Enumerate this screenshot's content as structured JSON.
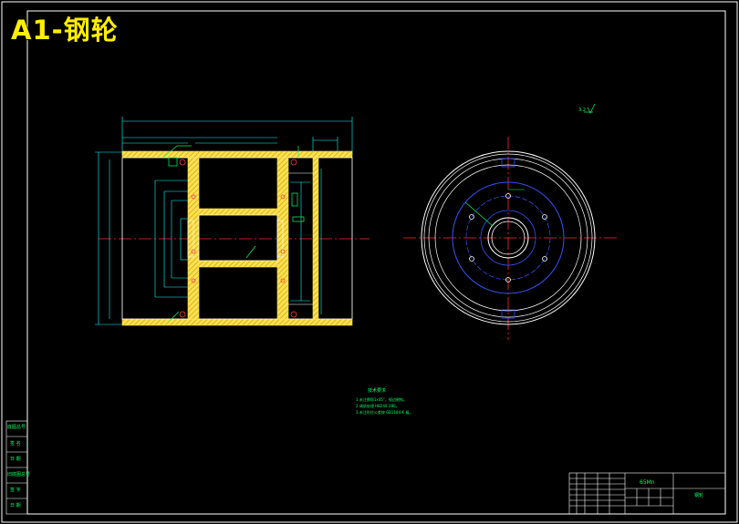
{
  "title": "A1-钢轮",
  "annotations": {
    "surface_mark": "3.2",
    "tech_req_heading": "技术要求",
    "tech_req_lines": [
      "1.未注倒角1x45°，锐边倒钝。",
      "2.调质处理 HB240-280。",
      "3.未注形位公差按 GB1184-K 级。"
    ]
  },
  "side_stamp_labels": [
    "底图总号",
    "签 名",
    "日 期",
    "旧底图总号",
    "签 字",
    "日 期"
  ],
  "title_block": {
    "material": "65Mn",
    "part_name": "钢轮"
  },
  "colors": {
    "frame": "#ffffff",
    "section_fill": "#ffe14d",
    "center_line": "#ff2a2a",
    "dimension": "#00ffff",
    "hidden_circle": "#3355ff",
    "text": "#00ff66"
  }
}
